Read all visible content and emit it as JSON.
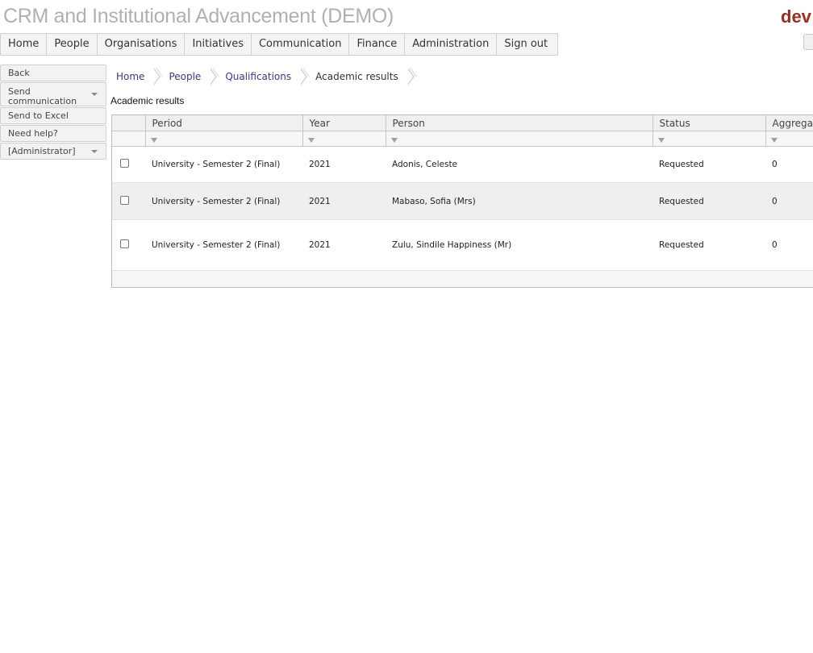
{
  "app": {
    "title": "CRM and Institutional Advancement (DEMO)",
    "brand": "dev"
  },
  "nav": {
    "items": [
      "Home",
      "People",
      "Organisations",
      "Initiatives",
      "Communication",
      "Finance",
      "Administration",
      "Sign out"
    ]
  },
  "sidebar": {
    "back": "Back",
    "send_communication": "Send communication",
    "send_to_excel": "Send to Excel",
    "need_help": "Need help?",
    "administrator": "[Administrator]"
  },
  "breadcrumb": {
    "items": [
      "Home",
      "People",
      "Qualifications",
      "Academic results"
    ]
  },
  "page": {
    "title": "Academic results"
  },
  "grid": {
    "columns": [
      "Period",
      "Year",
      "Person",
      "Status",
      "Aggregate"
    ],
    "rows": [
      [
        "University - Semester 2 (Final)",
        "2021",
        "Adonis, Celeste",
        "Requested",
        "0"
      ],
      [
        "University - Semester 2 (Final)",
        "2021",
        "Mabaso, Sofia (Mrs)",
        "Requested",
        "0"
      ],
      [
        "University - Semester 2 (Final)",
        "2021",
        "Zulu, Sindile Happiness (Mr)",
        "Requested",
        "0"
      ]
    ]
  },
  "colors": {
    "brand": "#a52a1a",
    "link": "#3a3a8c",
    "title_gray": "#b0b0b0"
  }
}
